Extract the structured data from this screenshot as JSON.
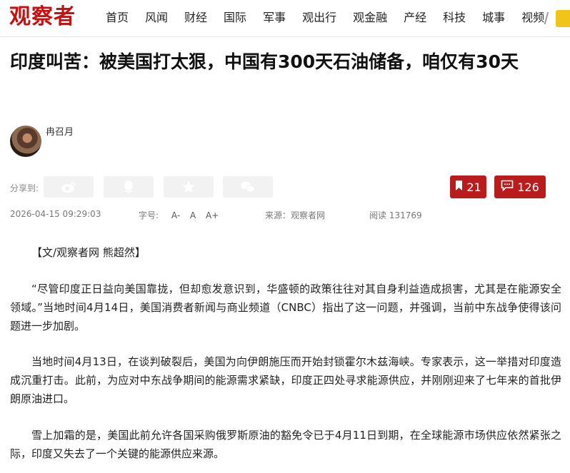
{
  "site": {
    "logo": "观察者"
  },
  "nav": [
    "首页",
    "风闻",
    "财经",
    "国际",
    "军事",
    "观出行",
    "观金融",
    "产经",
    "科技",
    "城事",
    "视频"
  ],
  "article": {
    "title": "印度叫苦：被美国打太狠，中国有300天石油储备，咱仅有30天",
    "author": "冉召月",
    "share_label": "分享到:",
    "share_icons": [
      "weibo-icon",
      "qq-icon",
      "star-icon",
      "wechat-icon"
    ],
    "bookmark_count": "21",
    "comment_count": "126",
    "date": "2026-04-15 09:29:03",
    "font_size_label": "字号:",
    "font_sizes": [
      "A-",
      "A",
      "A+"
    ],
    "source": "来源：观察者网",
    "reads": "阅读 131769",
    "paragraphs": [
      "【文/观察者网 熊超然】",
      "“尽管印度正日益向美国靠拢，但却愈发意识到，华盛顿的政策往往对其自身利益造成损害，尤其是在能源安全领域。”当地时间4月14日，美国消费者新闻与商业频道（CNBC）指出了这一问题，并强调，当前中东战争使得该问题进一步加剧。",
      "当地时间4月13日，在谈判破裂后，美国为向伊朗施压而开始封锁霍尔木兹海峡。专家表示，这一举措对印度造成沉重打击。此前，为应对中东战争期间的能源需求紧缺，印度正四处寻求能源供应，并刚刚迎来了七年来的首批伊朗原油进口。",
      "雪上加霜的是，美国此前允许各国采购俄罗斯原油的豁免令已于4月11日到期，在全球能源市场供应依然紧张之际，印度又失去了一个关键的能源供应来源。"
    ]
  },
  "colors": {
    "brand_red": "#c81010",
    "button_red": "#b81c1c"
  }
}
